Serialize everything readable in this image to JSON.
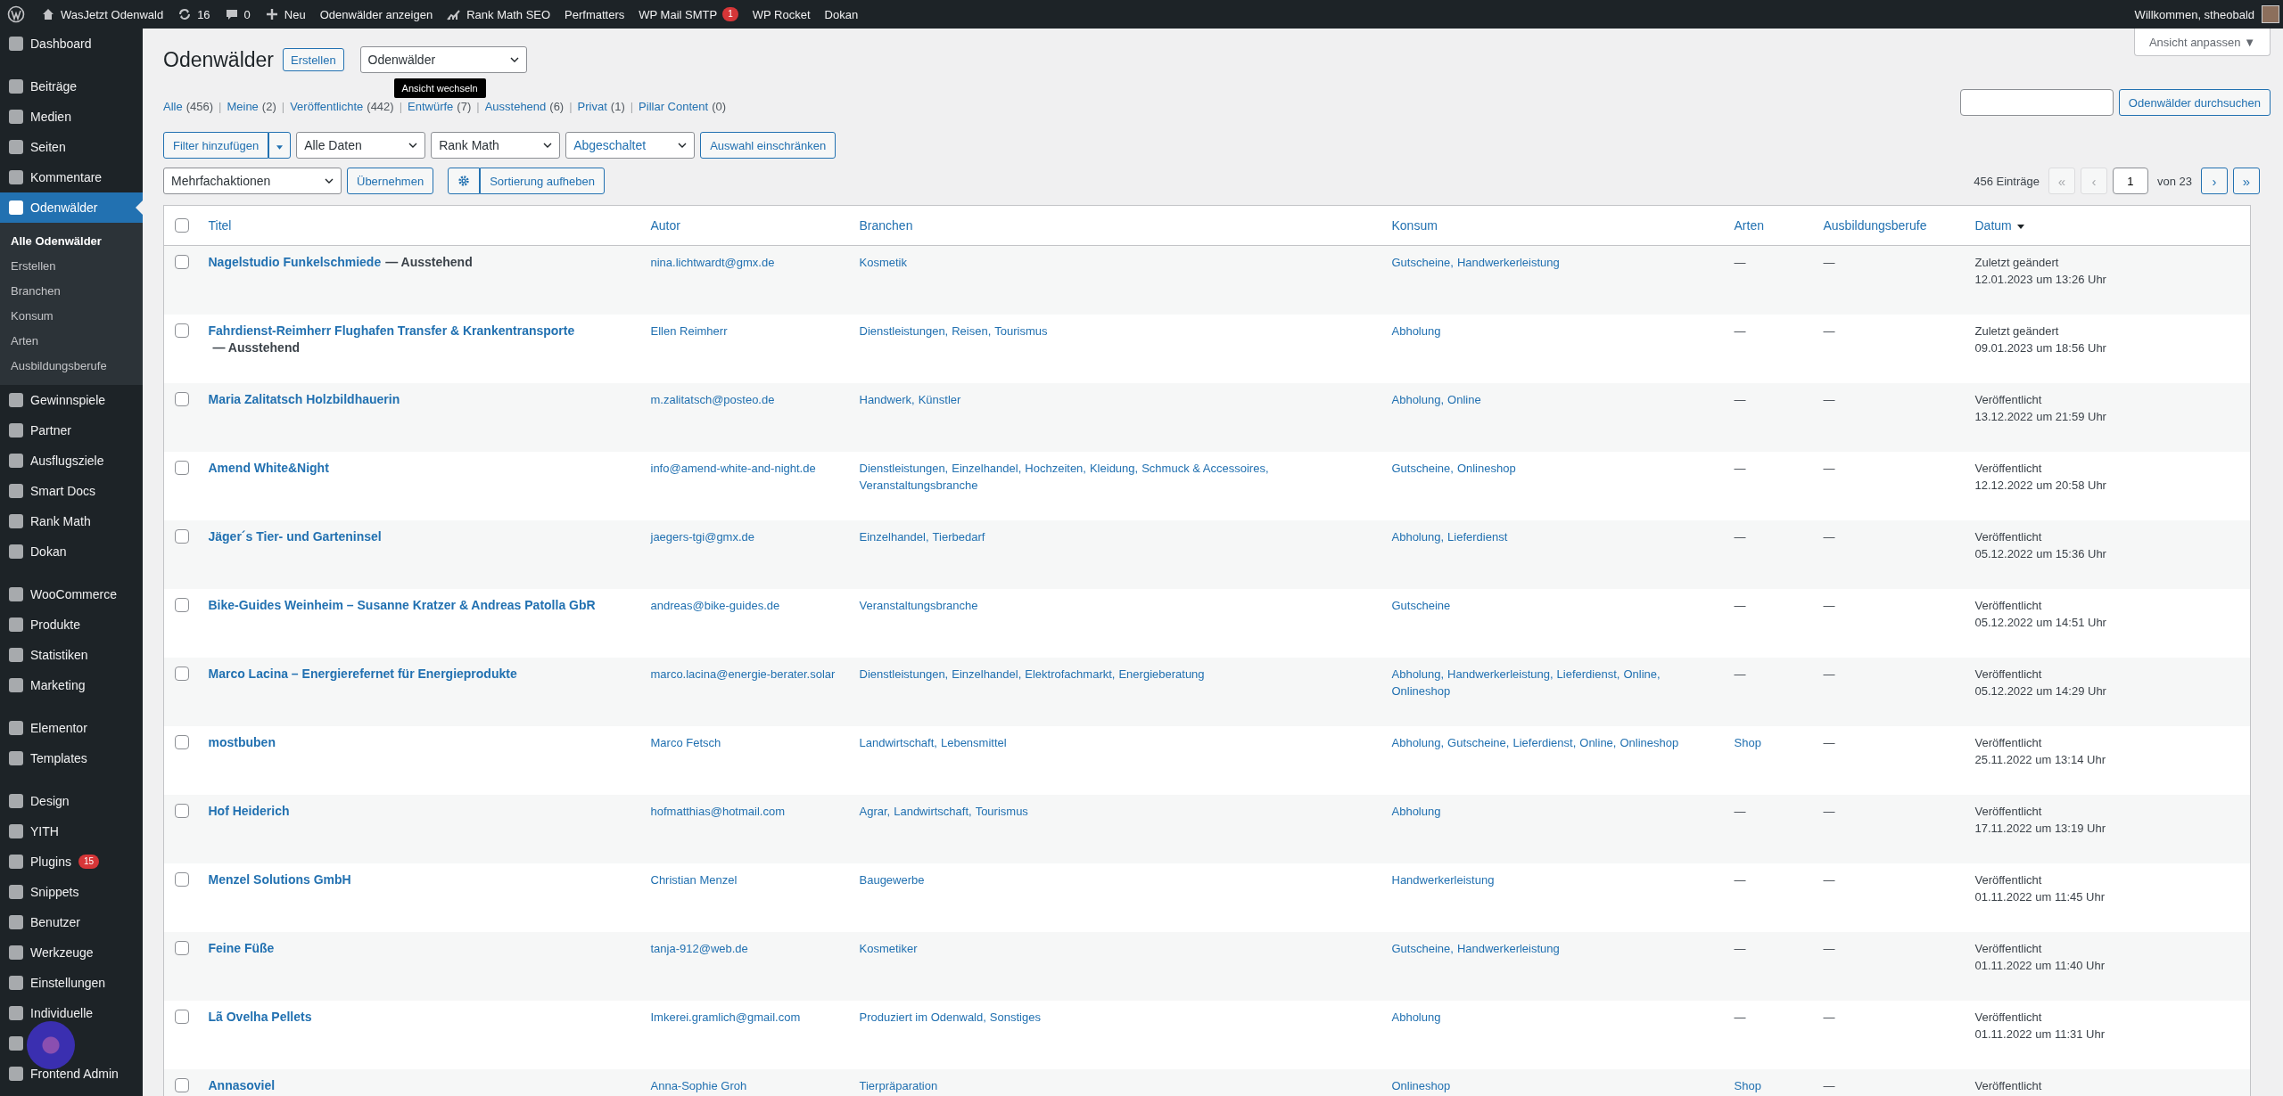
{
  "admin_bar": {
    "items": [
      {
        "label": "WasJetzt Odenwald"
      },
      {
        "label": "16"
      },
      {
        "label": "0"
      },
      {
        "label": "Neu"
      },
      {
        "label": "Odenwälder anzeigen"
      },
      {
        "label": "Rank Math SEO"
      },
      {
        "label": "Perfmatters"
      },
      {
        "label": "WP Mail SMTP",
        "badge": "1"
      },
      {
        "label": "WP Rocket"
      },
      {
        "label": "Dokan"
      }
    ],
    "greeting": "Willkommen, stheobald"
  },
  "sidebar": {
    "groups": [
      {
        "items": [
          {
            "label": "Dashboard",
            "selected": false
          }
        ]
      },
      {
        "items": [
          {
            "label": "Beiträge",
            "selected": false
          },
          {
            "label": "Medien",
            "selected": false
          },
          {
            "label": "Seiten",
            "selected": false
          },
          {
            "label": "Kommentare",
            "selected": false
          },
          {
            "label": "Odenwälder",
            "selected": true,
            "children": [
              {
                "label": "Alle Odenwälder",
                "selected": true
              },
              {
                "label": "Erstellen",
                "selected": false
              },
              {
                "label": "Branchen",
                "selected": false
              },
              {
                "label": "Konsum",
                "selected": false
              },
              {
                "label": "Arten",
                "selected": false
              },
              {
                "label": "Ausbildungsberufe",
                "selected": false
              }
            ]
          },
          {
            "label": "Gewinnspiele",
            "selected": false
          },
          {
            "label": "Partner",
            "selected": false
          },
          {
            "label": "Ausflugsziele",
            "selected": false
          },
          {
            "label": "Smart Docs",
            "selected": false
          },
          {
            "label": "Rank Math",
            "selected": false
          },
          {
            "label": "Dokan",
            "selected": false
          }
        ]
      },
      {
        "items": [
          {
            "label": "WooCommerce",
            "selected": false
          },
          {
            "label": "Produkte",
            "selected": false
          },
          {
            "label": "Statistiken",
            "selected": false
          },
          {
            "label": "Marketing",
            "selected": false
          }
        ]
      },
      {
        "items": [
          {
            "label": "Elementor",
            "selected": false
          },
          {
            "label": "Templates",
            "selected": false
          }
        ]
      },
      {
        "items": [
          {
            "label": "Design",
            "selected": false
          },
          {
            "label": "YITH",
            "selected": false
          },
          {
            "label": "Plugins",
            "badge": "15",
            "selected": false
          },
          {
            "label": "Snippets",
            "selected": false
          },
          {
            "label": "Benutzer",
            "selected": false
          },
          {
            "label": "Werkzeuge",
            "selected": false
          },
          {
            "label": "Einstellungen",
            "selected": false
          },
          {
            "label": "Individuelle",
            "selected": false
          },
          {
            "selected": false
          },
          {
            "label": "Frontend Admin",
            "selected": false
          }
        ]
      }
    ]
  },
  "screen_options": "Ansicht anpassen ▼",
  "page": {
    "title": "Odenwälder",
    "add_button": "Erstellen",
    "view_select": "Odenwälder",
    "tooltip": "Ansicht wechseln"
  },
  "views": [
    {
      "label": "Alle",
      "count": "(456)"
    },
    {
      "sep": "|",
      "label": "Meine",
      "count": "(2)"
    },
    {
      "sep": "|",
      "label": "Veröffentlichte",
      "count": "(442)"
    },
    {
      "sep": "|",
      "label": "Entwürfe",
      "count": "(7)"
    },
    {
      "sep": "|",
      "label": "Ausstehend",
      "count": "(6)"
    },
    {
      "sep": "|",
      "label": "Privat",
      "count": "(1)"
    },
    {
      "sep": "|",
      "label": "Pillar Content",
      "count": "(0)"
    }
  ],
  "search": {
    "button": "Odenwälder durchsuchen"
  },
  "filters": {
    "add_filter": "Filter hinzufügen",
    "selects": [
      {
        "value": "Alle Daten"
      },
      {
        "value": "Rank Math"
      },
      {
        "value": "Abgeschaltet"
      }
    ],
    "apply": "Auswahl einschränken"
  },
  "bulk": {
    "select": "Mehrfachaktionen",
    "apply": "Übernehmen",
    "reset_sort": "Sortierung aufheben"
  },
  "pagination": {
    "count": "456 Einträge",
    "buttons_before": [
      {
        "label": "«",
        "disabled": true
      },
      {
        "label": "‹",
        "disabled": true
      }
    ],
    "page": "1",
    "of": "von 23",
    "buttons_after": [
      {
        "label": "›",
        "disabled": false
      },
      {
        "label": "»",
        "disabled": false
      }
    ]
  },
  "table": {
    "select_all_checked": false,
    "columns": [
      {
        "label": "Titel"
      },
      {
        "label": "Autor"
      },
      {
        "label": "Branchen"
      },
      {
        "label": "Konsum"
      },
      {
        "label": "Arten"
      },
      {
        "label": "Ausbildungsberufe"
      },
      {
        "label": "Datum",
        "sorted": true
      }
    ],
    "rows": [
      {
        "checked": false,
        "title": "Nagelstudio Funkelschmiede",
        "status": "— Ausstehend",
        "author": "nina.lichtwardt@gmx.de",
        "branchen": [
          "Kosmetik"
        ],
        "konsum": [
          "Gutscheine,",
          "Handwerkerleistung"
        ],
        "arten": "—",
        "berufe": "—",
        "date_status": "Zuletzt geändert",
        "date": "12.01.2023 um 13:26 Uhr"
      },
      {
        "checked": false,
        "title": "Fahrdienst-Reimherr Flughafen Transfer & Krankentransporte",
        "status": "— Ausstehend",
        "author": "Ellen Reimherr",
        "branchen": [
          "Dienstleistungen,",
          "Reisen,",
          "Tourismus"
        ],
        "konsum": [
          "Abholung"
        ],
        "arten": "—",
        "berufe": "—",
        "date_status": "Zuletzt geändert",
        "date": "09.01.2023 um 18:56 Uhr"
      },
      {
        "checked": false,
        "title": "Maria Zalitatsch Holzbildhauerin",
        "author": "m.zalitatsch@posteo.de",
        "branchen": [
          "Handwerk,",
          "Künstler"
        ],
        "konsum": [
          "Abholung,",
          "Online"
        ],
        "arten": "—",
        "berufe": "—",
        "date_status": "Veröffentlicht",
        "date": "13.12.2022 um 21:59 Uhr"
      },
      {
        "checked": false,
        "title": "Amend White&Night",
        "author": "info@amend-white-and-night.de",
        "branchen": [
          "Dienstleistungen,",
          "Einzelhandel,",
          "Hochzeiten,",
          "Kleidung,",
          "Schmuck & Accessoires,",
          "Veranstaltungsbranche"
        ],
        "konsum": [
          "Gutscheine,",
          "Onlineshop"
        ],
        "arten": "—",
        "berufe": "—",
        "date_status": "Veröffentlicht",
        "date": "12.12.2022 um 20:58 Uhr"
      },
      {
        "checked": false,
        "title": "Jäger´s Tier- und Garteninsel",
        "author": "jaegers-tgi@gmx.de",
        "branchen": [
          "Einzelhandel,",
          "Tierbedarf"
        ],
        "konsum": [
          "Abholung,",
          "Lieferdienst"
        ],
        "arten": "—",
        "berufe": "—",
        "date_status": "Veröffentlicht",
        "date": "05.12.2022 um 15:36 Uhr"
      },
      {
        "checked": false,
        "title": "Bike-Guides Weinheim – Susanne Kratzer & Andreas Patolla GbR",
        "author": "andreas@bike-guides.de",
        "branchen": [
          "Veranstaltungsbranche"
        ],
        "konsum": [
          "Gutscheine"
        ],
        "arten": "—",
        "berufe": "—",
        "date_status": "Veröffentlicht",
        "date": "05.12.2022 um 14:51 Uhr"
      },
      {
        "checked": false,
        "title": "Marco Lacina – Energierefernet für Energieprodukte",
        "author": "marco.lacina@energie-berater.solar",
        "branchen": [
          "Dienstleistungen,",
          "Einzelhandel,",
          "Elektrofachmarkt,",
          "Energieberatung"
        ],
        "konsum": [
          "Abholung,",
          "Handwerkerleistung,",
          "Lieferdienst,",
          "Online,",
          "Onlineshop"
        ],
        "arten": "—",
        "berufe": "—",
        "date_status": "Veröffentlicht",
        "date": "05.12.2022 um 14:29 Uhr"
      },
      {
        "checked": false,
        "title": "mostbuben",
        "author": "Marco Fetsch",
        "branchen": [
          "Landwirtschaft,",
          "Lebensmittel"
        ],
        "konsum": [
          "Abholung,",
          "Gutscheine,",
          "Lieferdienst,",
          "Online,",
          "Onlineshop"
        ],
        "arten": [
          "Shop"
        ],
        "berufe": "—",
        "date_status": "Veröffentlicht",
        "date": "25.11.2022 um 13:14 Uhr"
      },
      {
        "checked": false,
        "title": "Hof Heiderich",
        "author": "hofmatthias@hotmail.com",
        "branchen": [
          "Agrar,",
          "Landwirtschaft,",
          "Tourismus"
        ],
        "konsum": [
          "Abholung"
        ],
        "arten": "—",
        "berufe": "—",
        "date_status": "Veröffentlicht",
        "date": "17.11.2022 um 13:19 Uhr"
      },
      {
        "checked": false,
        "title": "Menzel Solutions GmbH",
        "author": "Christian Menzel",
        "branchen": [
          "Baugewerbe"
        ],
        "konsum": [
          "Handwerkerleistung"
        ],
        "arten": "—",
        "berufe": "—",
        "date_status": "Veröffentlicht",
        "date": "01.11.2022 um 11:45 Uhr"
      },
      {
        "checked": false,
        "title": "Feine Füße",
        "author": "tanja-912@web.de",
        "branchen": [
          "Kosmetiker"
        ],
        "konsum": [
          "Gutscheine,",
          "Handwerkerleistung"
        ],
        "arten": "—",
        "berufe": "—",
        "date_status": "Veröffentlicht",
        "date": "01.11.2022 um 11:40 Uhr"
      },
      {
        "checked": false,
        "title": "Lã Ovelha Pellets",
        "author": "Imkerei.gramlich@gmail.com",
        "branchen": [
          "Produziert im Odenwald,",
          "Sonstiges"
        ],
        "konsum": [
          "Abholung"
        ],
        "arten": "—",
        "berufe": "—",
        "date_status": "Veröffentlicht",
        "date": "01.11.2022 um 11:31 Uhr"
      },
      {
        "checked": false,
        "title": "Annasoviel",
        "author": "Anna-Sophie Groh",
        "branchen": [
          "Tierpräparation"
        ],
        "konsum": [
          "Onlineshop"
        ],
        "arten": [
          "Shop"
        ],
        "berufe": "—",
        "date_status": "Veröffentlicht"
      }
    ]
  }
}
